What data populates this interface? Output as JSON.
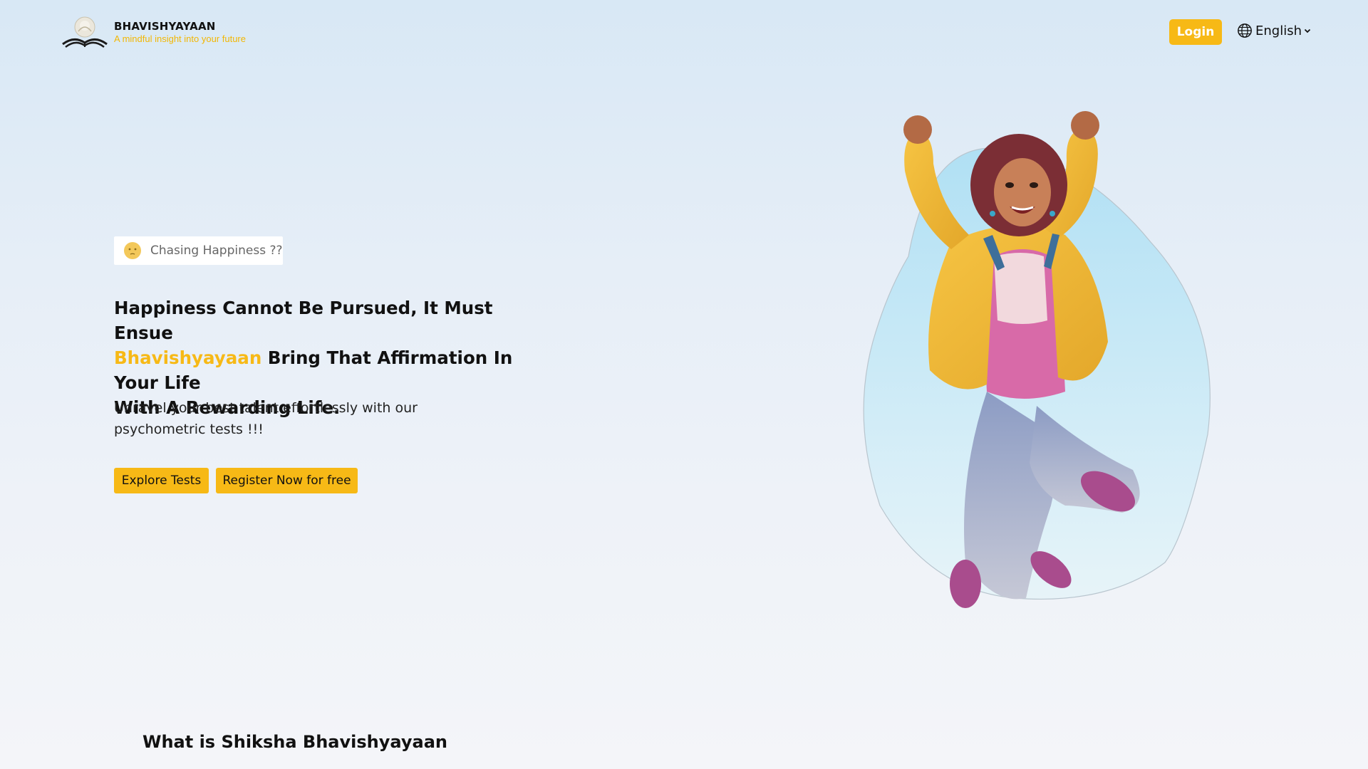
{
  "header": {
    "brand_name": "BHAVISHYAYAAN",
    "tagline": "A mindful insight into your future",
    "login_label": "Login",
    "language": "English"
  },
  "hero": {
    "pill_label": "Chasing Happiness ??",
    "heading_line1": "Happiness Cannot Be Pursued, It Must Ensue",
    "heading_brand": "Bhavishyayaan",
    "heading_line2_rest": " Bring That Affirmation In Your Life",
    "heading_line3": "With A Rewarding Life.",
    "subtext": "Unravel your best talent effortlessly with our psychometric tests !!!",
    "explore_label": "Explore Tests",
    "register_label": "Register Now for free"
  },
  "about": {
    "title": "What is Shiksha Bhavishyayaan"
  },
  "icons": {
    "logo": "open-book-lotus-logo",
    "globe": "globe-icon",
    "chevron": "chevron-down-icon",
    "pill_emoji": "thinking-face-emoji"
  },
  "colors": {
    "accent": "#f7b916",
    "tagline": "#f2b705",
    "text": "#111111"
  }
}
